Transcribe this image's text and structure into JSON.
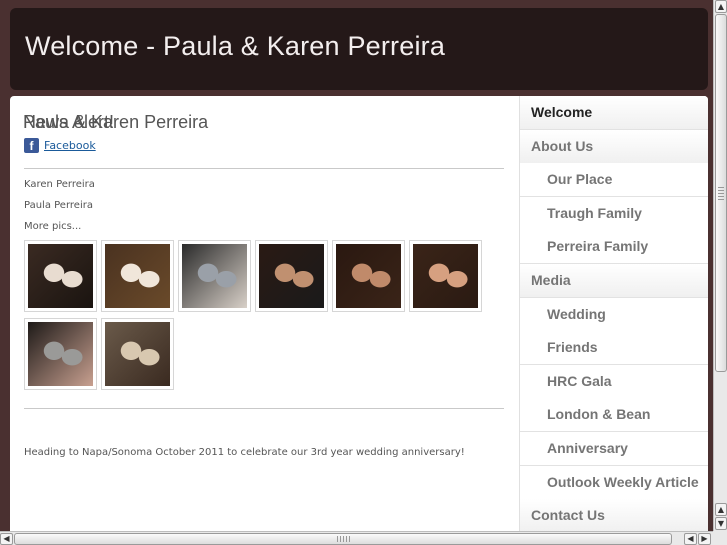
{
  "header": {
    "title": "Welcome - Paula & Karen Perreira"
  },
  "main": {
    "heading": "Paula & Karen Perreira",
    "facebook_link": "Facebook",
    "names": [
      "Karen Perreira",
      "Paula Perreira"
    ],
    "more_pics": "More pics...",
    "photos": [
      {
        "colors": [
          "#3a2a22",
          "#e8dcd0",
          "#1a1410"
        ]
      },
      {
        "colors": [
          "#4a3220",
          "#f0e6da",
          "#6a4a2a"
        ]
      },
      {
        "colors": [
          "#2a2a2a",
          "#9aa0a8",
          "#d8d0c8"
        ]
      },
      {
        "colors": [
          "#2a1a14",
          "#c09070",
          "#1a1a1a"
        ]
      },
      {
        "colors": [
          "#2a1810",
          "#c08a6a",
          "#3a2418"
        ]
      },
      {
        "colors": [
          "#3a2418",
          "#d6a080",
          "#2a1a12"
        ]
      },
      {
        "colors": [
          "#1e1a18",
          "#9a9a98",
          "#c8a090"
        ]
      },
      {
        "colors": [
          "#6a5a4a",
          "#d8c8b0",
          "#3a2a20"
        ]
      }
    ],
    "news_title": "News Alert!",
    "news_text": "Heading to Napa/Sonoma October 2011 to celebrate our 3rd year wedding anniversary!"
  },
  "sidebar": {
    "items": [
      {
        "label": "Welcome",
        "level": "top",
        "active": true
      },
      {
        "label": "About Us",
        "level": "top",
        "active": false
      },
      {
        "label": "Our Place",
        "level": "sub",
        "active": false
      },
      {
        "label": "Traugh Family",
        "level": "sub",
        "active": false
      },
      {
        "label": "Perreira Family",
        "level": "sub",
        "active": false
      },
      {
        "label": "Media",
        "level": "top",
        "active": false
      },
      {
        "label": "Wedding",
        "level": "sub",
        "active": false
      },
      {
        "label": "Friends",
        "level": "sub",
        "active": false
      },
      {
        "label": "HRC Gala",
        "level": "sub",
        "active": false
      },
      {
        "label": "London & Bean",
        "level": "sub",
        "active": false
      },
      {
        "label": "Anniversary",
        "level": "sub",
        "active": false
      },
      {
        "label": "Outlook Weekly Article",
        "level": "sub",
        "active": false
      },
      {
        "label": "Contact Us",
        "level": "top",
        "active": false
      }
    ]
  },
  "scrollbars": {
    "up_icon": "arrow-up-icon",
    "down_icon": "arrow-down-icon",
    "left_icon": "arrow-left-icon",
    "right_icon": "arrow-right-icon"
  },
  "colors": {
    "background": "#4a3030",
    "header_bg": "#241818",
    "header_text": "#f3eeee"
  }
}
